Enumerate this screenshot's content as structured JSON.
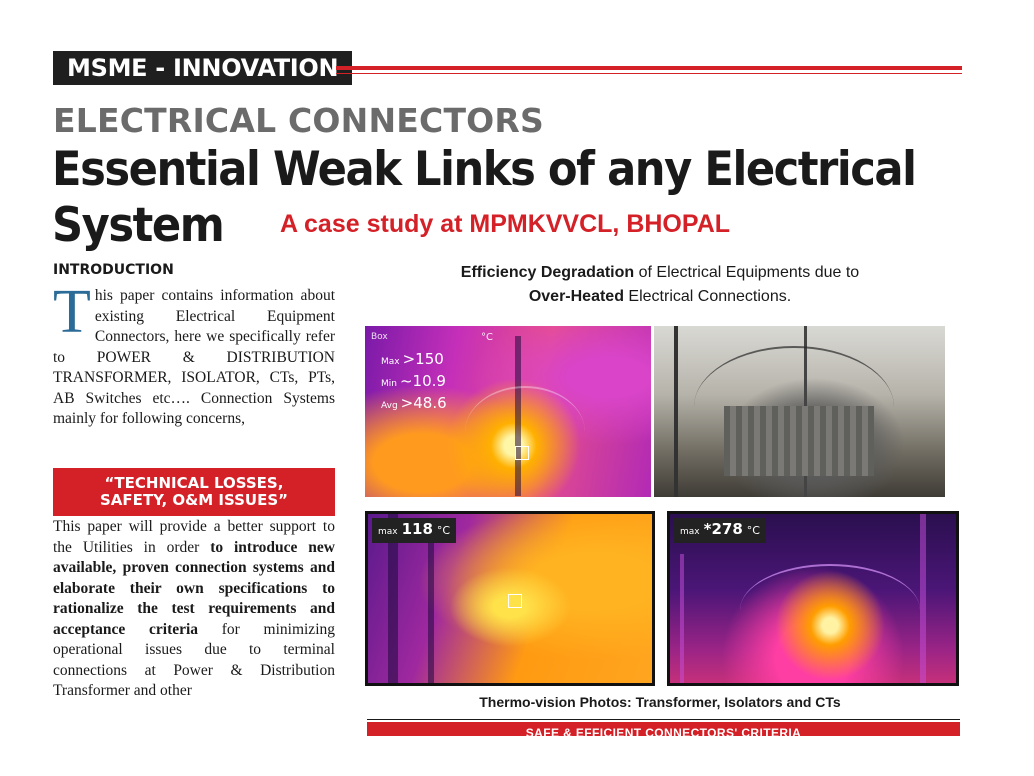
{
  "header": {
    "section_tag": "MSME - INNOVATION",
    "kicker": "ELECTRICAL CONNECTORS",
    "headline": "Essential Weak Links of any Electrical System",
    "subtitle": "A case study at MPMKVVCL, BHOPAL"
  },
  "left_column": {
    "intro_heading": "INTRODUCTION",
    "intro_dropcap": "T",
    "intro_text": "his paper contains information about existing Electrical Equipment Connectors, here we specifically refer to POWER & DISTRIBUTION TRANSFORMER, ISOLATOR, CTs, PTs, AB Switches etc…. Connection Systems mainly for following concerns,",
    "callout": "“TECHNICAL LOSSES, SAFETY, O&M ISSUES”",
    "body_lead": "This paper will provide a better support to the Utilities in order ",
    "body_bold": "to introduce new available, proven connection systems and elaborate their own specifications to rationalize the test requirements and acceptance criteria",
    "body_tail": " for minimizing operational issues due to terminal connections at Power & Distribution Transformer and other"
  },
  "figure": {
    "caption_bold1": "Efficiency Degradation",
    "caption_text1": " of Electrical Equipments due to",
    "caption_bold2": "Over-Heated",
    "caption_text2": " Electrical Connections.",
    "thermal1": {
      "box_label": "Box",
      "unit": "°C",
      "max_label": "Max",
      "max_value": ">150",
      "min_label": "Min",
      "min_value": "~10.9",
      "avg_label": "Avg",
      "avg_value": ">48.6"
    },
    "thermal3": {
      "max_label": "max",
      "max_value": "118",
      "unit": "°C"
    },
    "thermal4": {
      "max_label": "max",
      "max_value": "*278",
      "unit": "°C"
    },
    "caption_bottom": "Thermo-vision Photos: Transformer, Isolators and CTs"
  },
  "next_section_banner": "SAFE & EFFICIENT CONNECTORS' CRITERIA"
}
